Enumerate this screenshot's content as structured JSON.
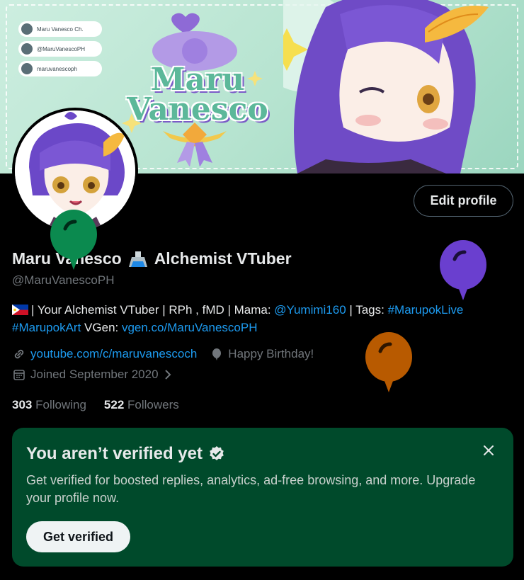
{
  "banner": {
    "social": {
      "youtube": "Maru Vanesco Ch.",
      "twitter": "@MaruVanescoPH",
      "tiktok": "maruvanescoph"
    },
    "logo_line1": "Maru",
    "logo_line2": "Vanesco"
  },
  "profile": {
    "edit_label": "Edit profile",
    "name_part1": "Maru Vanesco",
    "name_part2": "Alchemist VTuber",
    "handle": "@MaruVanescoPH"
  },
  "bio": {
    "text1": "| Your Alchemist VTuber | RPh , fMD | Mama: ",
    "mention": "@Yumimi160",
    "text2": " | Tags: ",
    "tag1": "#MarupokLive",
    "tag2": "#MarupokArt",
    "text3": " VGen: ",
    "vgen_link": "vgen.co/MaruVanescoPH"
  },
  "meta": {
    "website": "youtube.com/c/maruvanescoch",
    "birthday": "Happy Birthday!",
    "joined": "Joined September 2020"
  },
  "stats": {
    "following_count": "303",
    "following_label": "Following",
    "followers_count": "522",
    "followers_label": "Followers"
  },
  "verify": {
    "title": "You aren’t verified yet",
    "description": "Get verified for boosted replies, analytics, ad-free browsing, and more. Upgrade your profile now.",
    "button_label": "Get verified"
  },
  "colors": {
    "link": "#1d9bf0",
    "verify_bg": "#004a2b",
    "balloon_green": "#0b8a4f",
    "balloon_purple": "#6a3fcf",
    "balloon_orange": "#b85a00"
  }
}
